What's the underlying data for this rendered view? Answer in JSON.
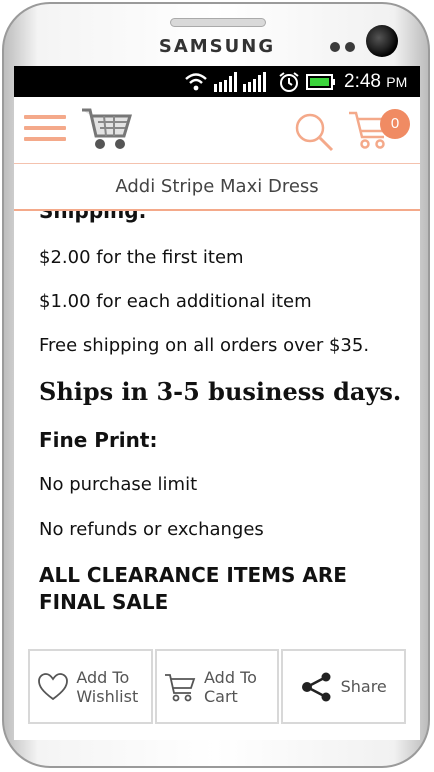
{
  "device": {
    "brand": "SAMSUNG"
  },
  "status_bar": {
    "time": "2:48",
    "ampm": "PM"
  },
  "app_bar": {
    "cart_count": "0"
  },
  "page": {
    "title": "Addi Stripe Maxi Dress"
  },
  "content": {
    "shipping_heading": "Shipping:",
    "lines": [
      "$2.00 for the first item",
      "$1.00 for each additional item",
      "Free shipping on all orders over $35."
    ],
    "ships_heading": "Ships in 3-5 business days.",
    "fine_print_heading": "Fine Print:",
    "fine_print": [
      "No purchase limit",
      "No refunds or exchanges"
    ],
    "final_sale": "ALL CLEARANCE ITEMS ARE FINAL SALE"
  },
  "actions": {
    "wishlist_line1": "Add To",
    "wishlist_line2": "Wishlist",
    "cart_line1": "Add To",
    "cart_line2": "Cart",
    "share": "Share"
  },
  "colors": {
    "accent": "#f08b63",
    "accent_light": "#f4a98a"
  }
}
